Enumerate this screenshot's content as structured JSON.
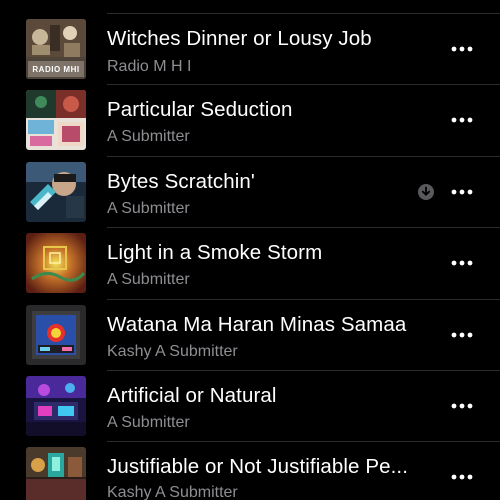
{
  "songs": [
    {
      "title": "Witches Dinner or Lousy Job",
      "artist": "Radio M H I",
      "artwork_text": "RADIO MHI",
      "downloaded": false
    },
    {
      "title": "Particular Seduction",
      "artist": "A Submitter",
      "downloaded": false
    },
    {
      "title": "Bytes Scratchin'",
      "artist": "A Submitter",
      "downloaded": true
    },
    {
      "title": "Light in a Smoke Storm",
      "artist": "A Submitter",
      "downloaded": false
    },
    {
      "title": "Watana Ma Haran Minas Samaa",
      "artist": "Kashy A Submitter",
      "downloaded": false
    },
    {
      "title": "Artificial or Natural",
      "artist": "A Submitter",
      "downloaded": false
    },
    {
      "title": "Justifiable or Not Justifiable Pe...",
      "artist": "Kashy A Submitter",
      "downloaded": false
    }
  ],
  "colors": {
    "background": "#000000",
    "title": "#ffffff",
    "subtitle": "#8e8e93",
    "separator": "#2a2a2c",
    "more_dots": "#ffffff",
    "download_badge": "#5a5a5e"
  },
  "icons": {
    "more": "ellipsis-icon",
    "download": "downloaded-arrow-icon"
  }
}
